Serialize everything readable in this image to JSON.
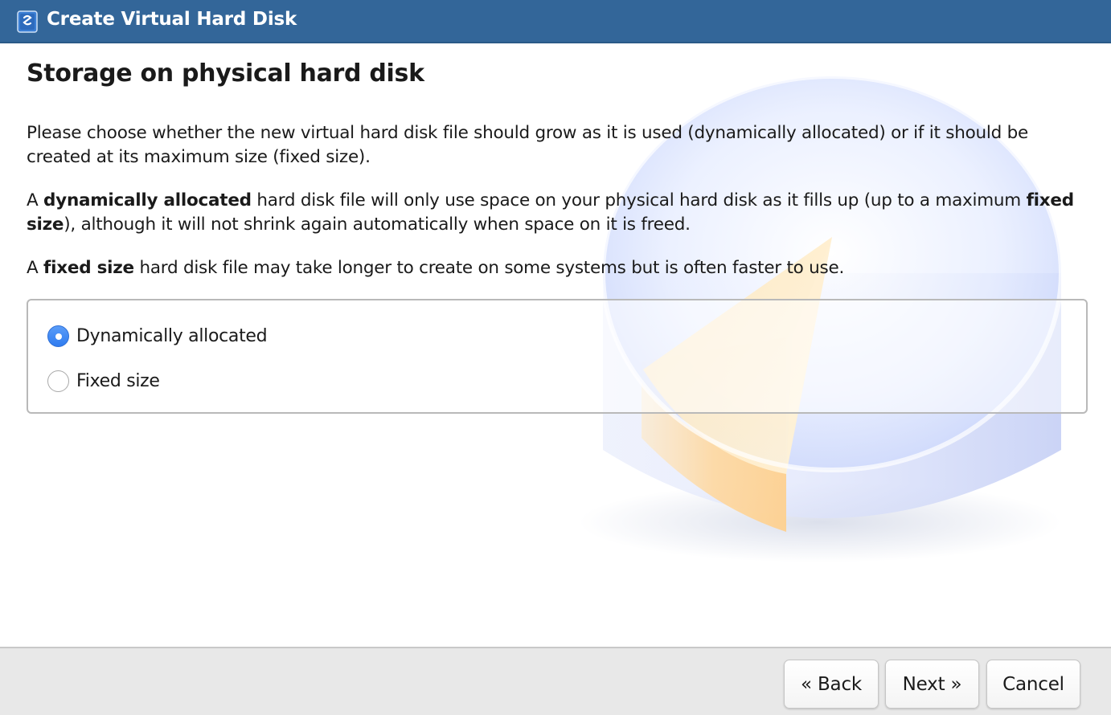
{
  "window": {
    "title": "Create Virtual Hard Disk",
    "app_icon": "virtualbox-icon"
  },
  "page": {
    "heading": "Storage on physical hard disk",
    "para1": "Please choose whether the new virtual hard disk file should grow as it is used (dynamically allocated) or if it should be created at its maximum size (fixed size).",
    "para2": {
      "prefix": "A ",
      "bold1": "dynamically allocated",
      "middle": " hard disk file will only use space on your physical hard disk as it fills up (up to a maximum ",
      "bold2": "fixed size",
      "suffix": "), although it will not shrink again automatically when space on it is freed."
    },
    "para3": {
      "prefix": "A ",
      "bold": "fixed size",
      "suffix": " hard disk file may take longer to create on some systems but is often faster to use."
    }
  },
  "options": {
    "items": [
      {
        "label": "Dynamically allocated",
        "selected": true
      },
      {
        "label": "Fixed size",
        "selected": false
      }
    ]
  },
  "buttons": {
    "back": "« Back",
    "next": "Next »",
    "cancel": "Cancel"
  },
  "colors": {
    "titlebar": "#336699",
    "accent": "#2f7cf0",
    "button_bar": "#e8e8e8"
  }
}
